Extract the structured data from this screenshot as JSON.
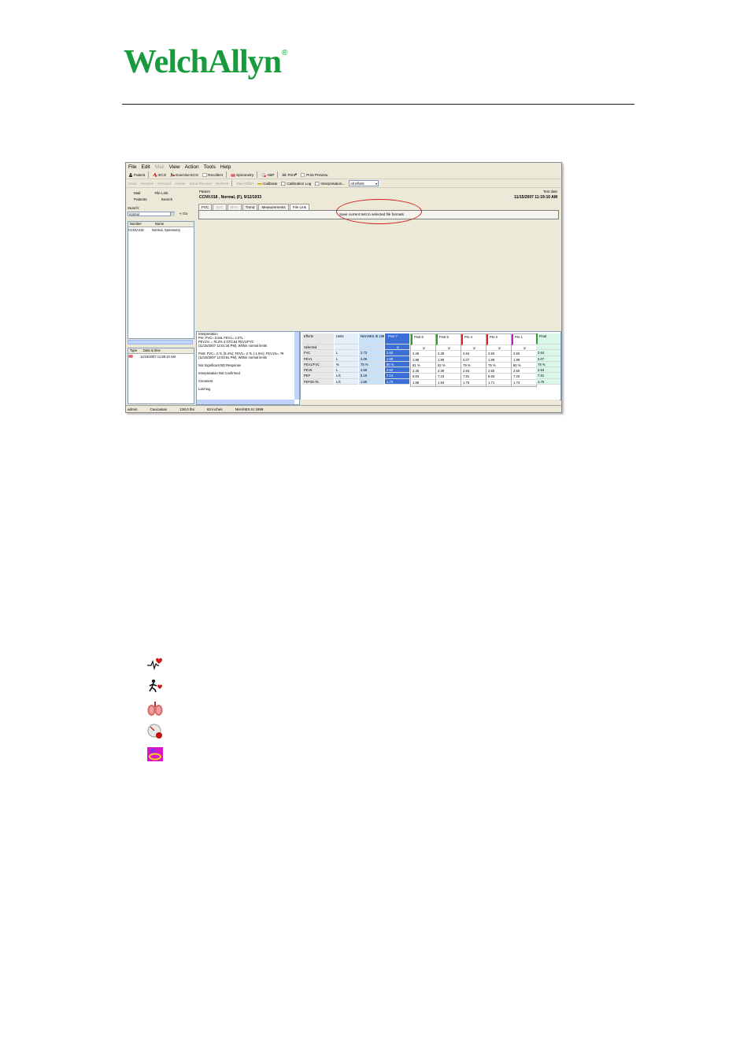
{
  "brand": {
    "name": "WelchAllyn",
    "reg": "®"
  },
  "app": {
    "menu": [
      "File",
      "Edit",
      "Mail",
      "View",
      "Action",
      "Tools",
      "Help"
    ],
    "menu_disabled": [
      false,
      false,
      true,
      false,
      false,
      false,
      false
    ],
    "toolbar1": [
      "Patient",
      "ECG",
      "Exercise ECG",
      "Recollect",
      "Spirometry",
      "ABP",
      "Print",
      "Print Preview"
    ],
    "toolbar2": [
      "Send",
      "Receive",
      "Forward",
      "Delete",
      "Send Receive",
      "Refresh",
      "Take Effort",
      "Calibrate",
      "Calibration Log",
      "Interpretation..."
    ],
    "effort_select": "All efforts",
    "nav": {
      "mail": "Mail",
      "file_link": "File Link",
      "patients": "Patients",
      "search": "Search"
    },
    "search_label": "Search:",
    "search_value": "normal",
    "go_label": "Go",
    "patient_cols": [
      "Number",
      "Name"
    ],
    "patient_rows": [
      {
        "number": "CCNV.018",
        "name": "Normal, Spirometry"
      }
    ],
    "test_cols": [
      "Type",
      "Date & time"
    ],
    "test_rows": [
      {
        "date": "11/15/2007 11:59:10 AM"
      }
    ],
    "patient_label": "Patient",
    "patient_name": "CCNV.018 , Normal, (F), 9/12/1933",
    "test_date_label": "Test date",
    "test_date": "11/15/2007 11:19:10 AM",
    "tabs": [
      "FVC",
      "SVC",
      "MVV",
      "Trend",
      "Measurements",
      "File Link"
    ],
    "tabs_disabled": [
      false,
      true,
      true,
      false,
      false,
      false
    ],
    "file_link_button": "Save current test to selected file formats",
    "interpretation_lines": [
      "Interpretation",
      "Pre: FVC= 2.64L FEV1= 2.07L",
      "FEV1% = 78.2% 2.07/2.64 FEV1/FVC",
      "(11/15/2007 12:01:34 PM). Within normal limits",
      "",
      "Post: FVC= 2.?L (5.4%); FEV1= 2.?L (-1.5%); FEV1%= 79",
      "(11/15/2007 12:03:51 PM). Within normal limits",
      "",
      "Not Significant BD Response",
      "",
      "Interpretation Not Confirmed",
      "",
      "Comment",
      "",
      "Last tag"
    ],
    "grid": {
      "row_labels": [
        "Efforts",
        "Selected",
        "FVC",
        "FEV1",
        "FEV1/FVC",
        "FEV6",
        "PEF",
        "FEF25-75"
      ],
      "units": [
        "Units",
        "",
        "L",
        "L",
        "%",
        "L",
        "L/s",
        "L/s"
      ],
      "ref": [
        "NHANES III 1999",
        "",
        "2.73",
        "2.05",
        "75 %",
        "2.59",
        "5.19",
        "1.65"
      ],
      "trials": [
        {
          "name": "Post 7",
          "vals": [
            "2.50",
            "1.98",
            "80 %",
            "2.50",
            "7.13",
            "1.75"
          ]
        },
        {
          "name": "Post 6",
          "vals": [
            "2.46",
            "1.98",
            "81 %",
            "2.46",
            "6.93",
            "1.88"
          ]
        },
        {
          "name": "Post 5",
          "vals": [
            "2.38",
            "1.90",
            "82 %",
            "2.38",
            "7.23",
            "1.94"
          ]
        },
        {
          "name": "Pre 4",
          "vals": [
            "2.64",
            "2.07",
            "79 %",
            "2.64",
            "7.81",
            "1.75"
          ]
        },
        {
          "name": "Pre 2",
          "vals": [
            "2.50",
            "1.89",
            "75 %",
            "2.50",
            "6.93",
            "1.71"
          ]
        },
        {
          "name": "Pre 1",
          "vals": [
            "2.50",
            "1.99",
            "80 %",
            "2.50",
            "7.20",
            "1.74"
          ]
        },
        {
          "name": "Final",
          "vals": [
            "2.64",
            "2.07",
            "78 %",
            "2.64",
            "7.81",
            "1.75"
          ]
        }
      ]
    },
    "status": [
      "admin",
      "Caucasian",
      "136.0 lbs",
      "63 inches",
      "NHANES III 1999"
    ]
  },
  "legend_icons": [
    "ecg-heart-icon",
    "exercise-ecg-icon",
    "spirometry-lungs-icon",
    "abp-gauge-icon",
    "file-link-icon"
  ]
}
